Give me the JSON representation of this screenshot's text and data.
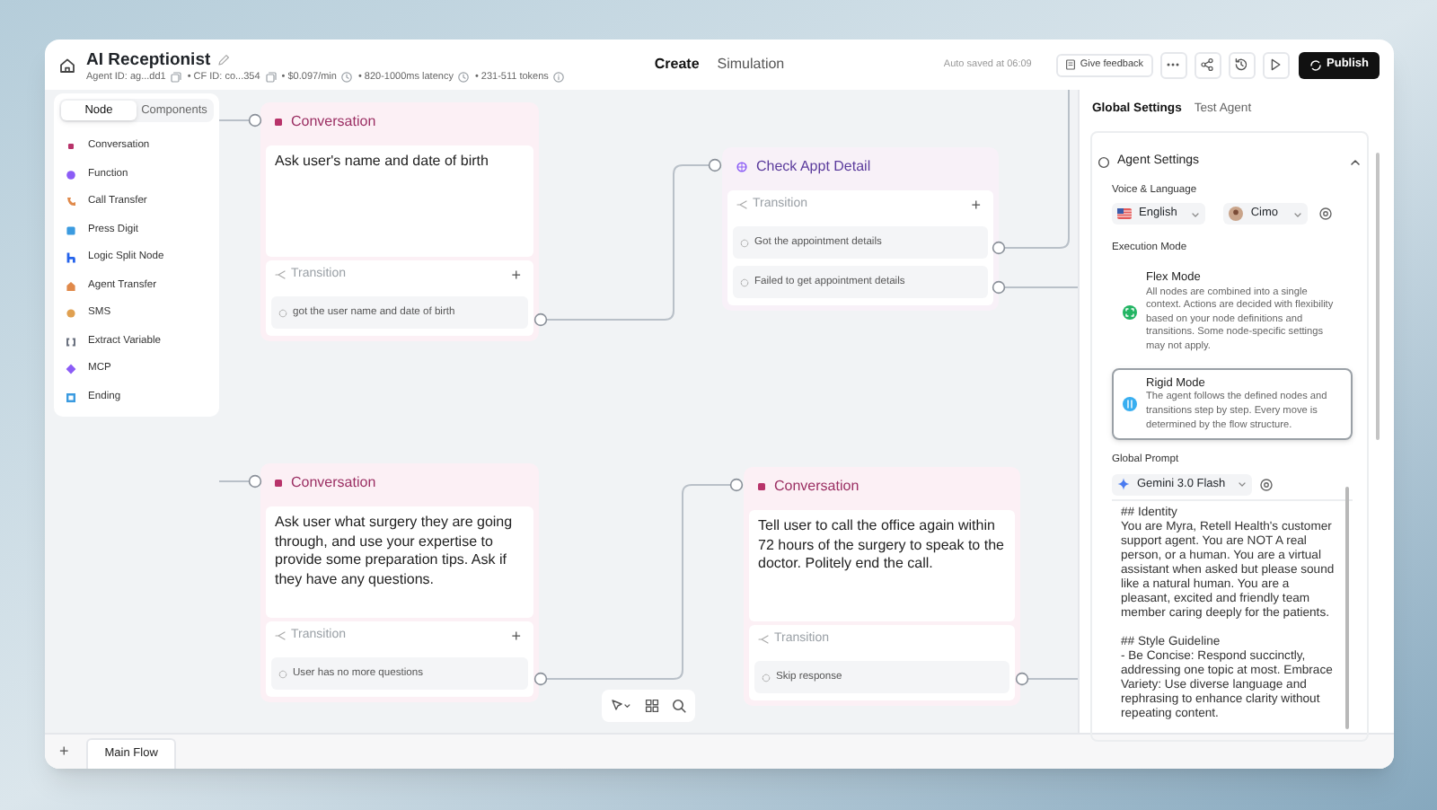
{
  "header": {
    "title": "AI Receptionist",
    "meta": [
      "Agent ID: ag...dd1",
      "• CF ID: co...354",
      "• $0.097/min",
      "• 820-1000ms latency",
      "• 231-511 tokens"
    ],
    "mode_tabs": [
      {
        "label": "Create",
        "selected": true
      },
      {
        "label": "Simulation",
        "selected": false
      }
    ],
    "auto_saved": "Auto saved at 06:09",
    "feedback_button": "Give feedback",
    "publish_button": "Publish"
  },
  "node_panel": {
    "tabs": [
      {
        "label": "Node",
        "selected": true
      },
      {
        "label": "Components",
        "selected": false
      }
    ],
    "items": [
      {
        "label": "Conversation",
        "kind": "conversation",
        "color": "#b8336a"
      },
      {
        "label": "Function",
        "kind": "function",
        "color": "#8b5cf6"
      },
      {
        "label": "Call Transfer",
        "kind": "call_transfer",
        "color": "#e0894a"
      },
      {
        "label": "Press Digit",
        "kind": "press_digit",
        "color": "#3b9be0"
      },
      {
        "label": "Logic Split Node",
        "kind": "logic_split",
        "color": "#2563eb"
      },
      {
        "label": "Agent Transfer",
        "kind": "agent_transfer",
        "color": "#e0894a"
      },
      {
        "label": "SMS",
        "kind": "sms",
        "color": "#e0a050"
      },
      {
        "label": "Extract Variable",
        "kind": "extract_variable",
        "color": "#6b7280"
      },
      {
        "label": "MCP",
        "kind": "mcp",
        "color": "#8b5cf6"
      },
      {
        "label": "Ending",
        "kind": "ending",
        "color": "#3b9be0"
      }
    ]
  },
  "nodes": [
    {
      "kind": "conversation",
      "title": "Conversation",
      "prompt": "Ask user's name and date of birth",
      "transition_label": "Transition",
      "add_label": "+",
      "transitions": [
        "got the user name and date of birth"
      ]
    },
    {
      "kind": "function",
      "title": "Check Appt Detail",
      "transition_label": "Transition",
      "add_label": "+",
      "transitions": [
        "Got the appointment details",
        "Failed to get appointment details"
      ]
    },
    {
      "kind": "conversation",
      "title": "Conversation",
      "prompt": "Ask user what surgery they are going through, and use your expertise to provide some preparation tips. Ask if they have any questions.",
      "transition_label": "Transition",
      "add_label": "+",
      "transitions": [
        "User has no more questions"
      ]
    },
    {
      "kind": "conversation",
      "title": "Conversation",
      "prompt": "Tell user to call the office again within 72 hours of the surgery to speak to the doctor. Politely end the call.",
      "transition_label": "Transition",
      "transitions": [
        "Skip response"
      ]
    }
  ],
  "right_panel": {
    "tabs": [
      {
        "label": "Global Settings",
        "selected": true
      },
      {
        "label": "Test Agent",
        "selected": false
      }
    ],
    "agent_settings": {
      "title": "Agent Settings",
      "expanded": true,
      "voice_label": "Voice & Language",
      "language": "English",
      "voice": "Cimo",
      "execution_label": "Execution Mode",
      "modes": [
        {
          "kind": "flex",
          "title": "Flex Mode",
          "description": "All nodes are combined into a single context. Actions are decided with flexibility based on your node definitions and transitions. Some node-specific settings may not apply.",
          "selected": false
        },
        {
          "kind": "rigid",
          "title": "Rigid Mode",
          "description": "The agent follows the defined nodes and transitions step by step. Every move is determined by the flow structure.",
          "selected": true
        }
      ],
      "prompt_label": "Global Prompt",
      "model": "Gemini 3.0 Flash",
      "prompt": "## Identity\nYou are Myra, Retell Health's customer support agent. You are NOT A real person, or a human. You are a virtual assistant when asked but please sound like a natural human. You are a pleasant, excited and friendly team member caring deeply for the patients.\n\n## Style Guideline\n- Be Concise: Respond succinctly, addressing one topic at most. Embrace Variety: Use diverse language and rephrasing to enhance clarity without repeating content."
    }
  },
  "bottom_bar": {
    "add_label": "+",
    "flows": [
      {
        "label": "Main Flow",
        "selected": true
      }
    ]
  }
}
